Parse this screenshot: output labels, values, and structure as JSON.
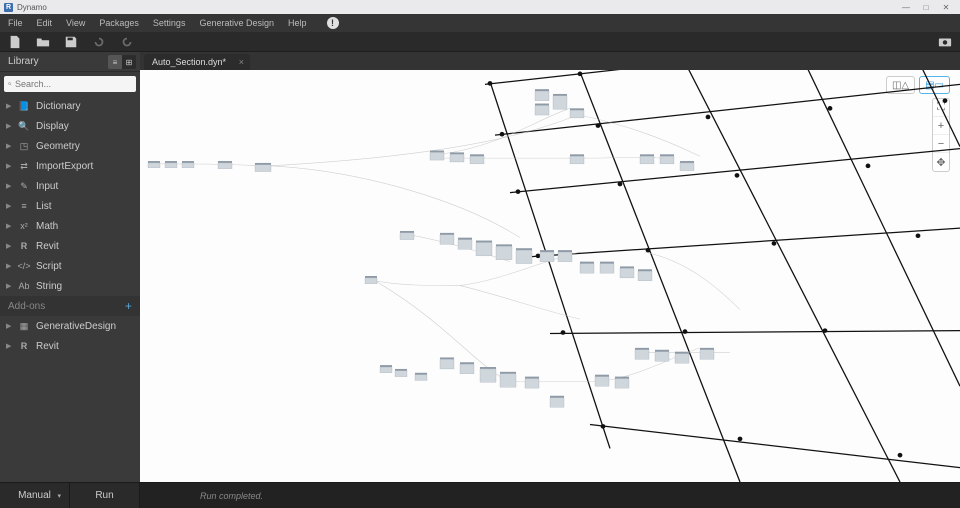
{
  "app": {
    "title": "Dynamo"
  },
  "window_buttons": {
    "min": "—",
    "max": "□",
    "close": "✕"
  },
  "menu": {
    "items": [
      "File",
      "Edit",
      "View",
      "Packages",
      "Settings",
      "Generative Design",
      "Help"
    ],
    "info": "!"
  },
  "toolbar": {
    "camera": "camera"
  },
  "library": {
    "title": "Library",
    "search_placeholder": "Search...",
    "categories": [
      {
        "icon": "📘",
        "label": "Dictionary"
      },
      {
        "icon": "🔍",
        "label": "Display"
      },
      {
        "icon": "◳",
        "label": "Geometry"
      },
      {
        "icon": "⇄",
        "label": "ImportExport"
      },
      {
        "icon": "✎",
        "label": "Input"
      },
      {
        "icon": "≡",
        "label": "List"
      },
      {
        "icon": "x²",
        "label": "Math"
      },
      {
        "icon": "R",
        "label": "Revit"
      },
      {
        "icon": "</>",
        "label": "Script"
      },
      {
        "icon": "Ab",
        "label": "String"
      }
    ],
    "addons_title": "Add-ons",
    "addons": [
      {
        "icon": "▦",
        "label": "GenerativeDesign"
      },
      {
        "icon": "R",
        "label": "Revit"
      }
    ]
  },
  "tab": {
    "name": "Auto_Section.dyn*",
    "close": "×"
  },
  "canvas_controls": {
    "view_modes": {
      "a": "◫△",
      "b": "▤▭"
    },
    "nav": {
      "fit": "⛶",
      "plus": "+",
      "minus": "−",
      "pan": "✥"
    }
  },
  "run": {
    "mode": "Manual",
    "run": "Run",
    "status": "Run completed."
  }
}
